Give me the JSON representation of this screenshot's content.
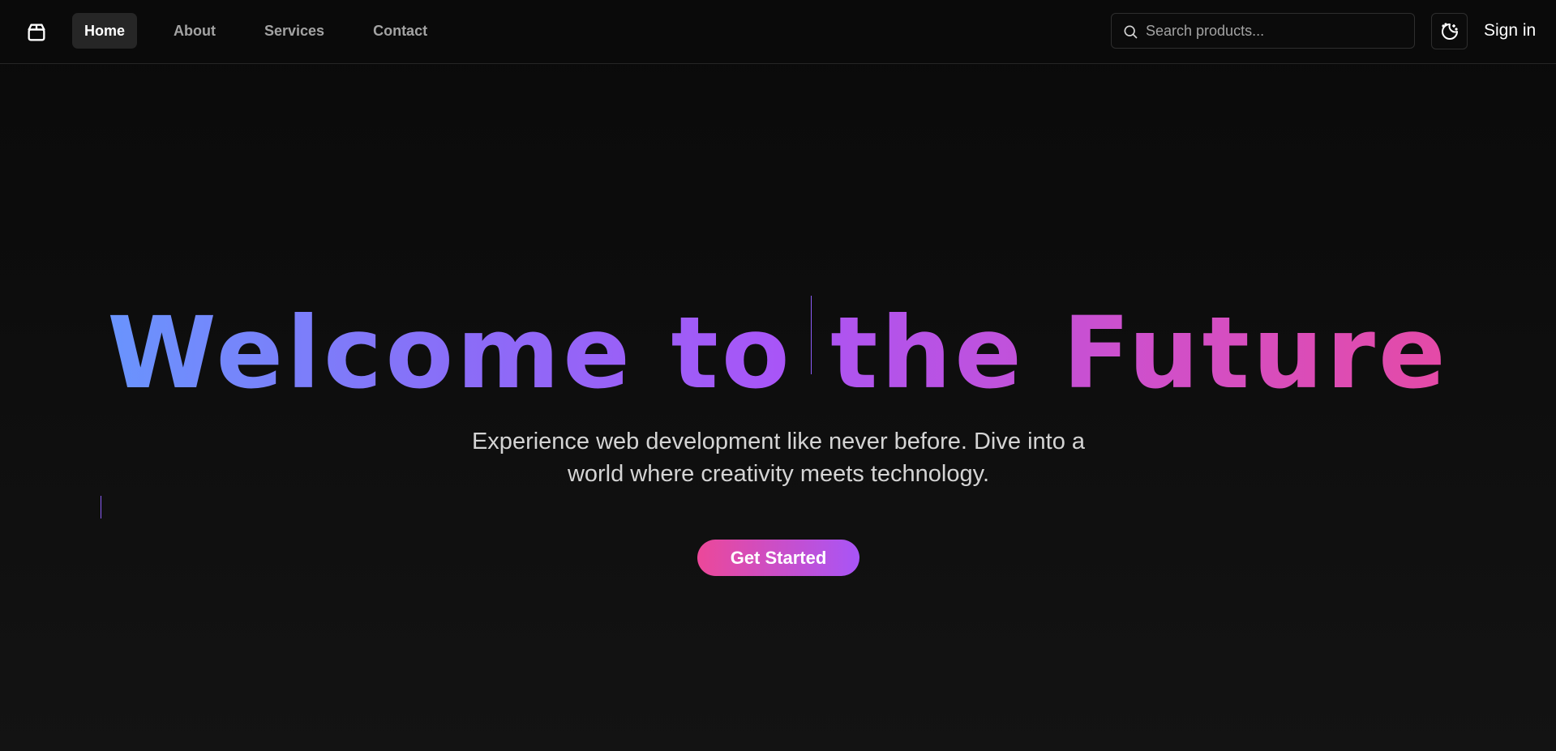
{
  "header": {
    "logo_icon": "package-icon",
    "nav": [
      {
        "label": "Home",
        "active": true
      },
      {
        "label": "About",
        "active": false
      },
      {
        "label": "Services",
        "active": false
      },
      {
        "label": "Contact",
        "active": false
      }
    ],
    "search": {
      "placeholder": "Search products...",
      "value": "",
      "icon": "search-icon"
    },
    "theme_toggle_icon": "moon-stars-icon",
    "sign_in_label": "Sign in"
  },
  "hero": {
    "title": "Welcome to the Future",
    "subtitle_line1": "Experience web development like never before. Dive into a",
    "subtitle_line2": "world where creativity meets technology.",
    "cta_label": "Get Started"
  },
  "colors": {
    "background": "#0a0a0a",
    "gradient_start": "#5fa0ff",
    "gradient_mid": "#a855f7",
    "gradient_end": "#ec4899",
    "button_start": "#ec4899",
    "button_end": "#a855f7"
  }
}
